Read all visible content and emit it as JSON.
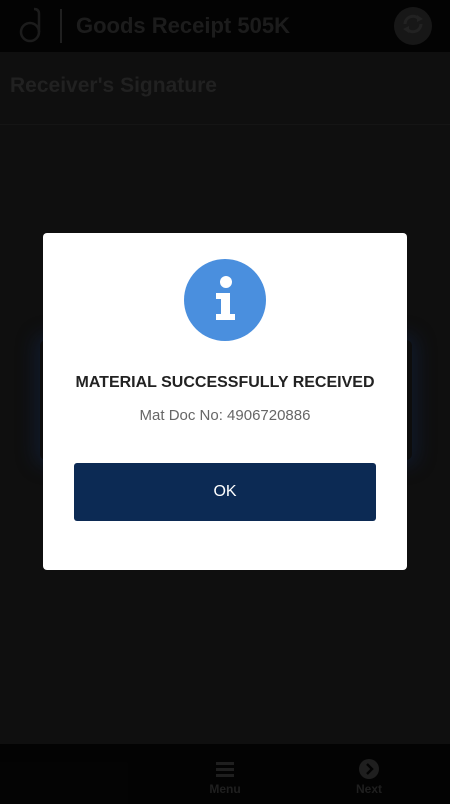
{
  "header": {
    "title": "Goods Receipt 505K",
    "logo_icon": "d-logo-icon",
    "sync_icon": "sync-icon"
  },
  "section": {
    "title": "Receiver's Signature"
  },
  "dialog": {
    "icon": "info-icon",
    "icon_color": "#4a8fde",
    "title": "MATERIAL SUCCESSFULLY RECEIVED",
    "message": "Mat Doc No: 4906720886",
    "ok_label": "OK",
    "ok_color": "#0c2a54"
  },
  "bottom_nav": {
    "menu_label": "Menu",
    "menu_icon": "hamburger-icon",
    "next_label": "Next",
    "next_icon": "arrow-right-circle-icon"
  }
}
